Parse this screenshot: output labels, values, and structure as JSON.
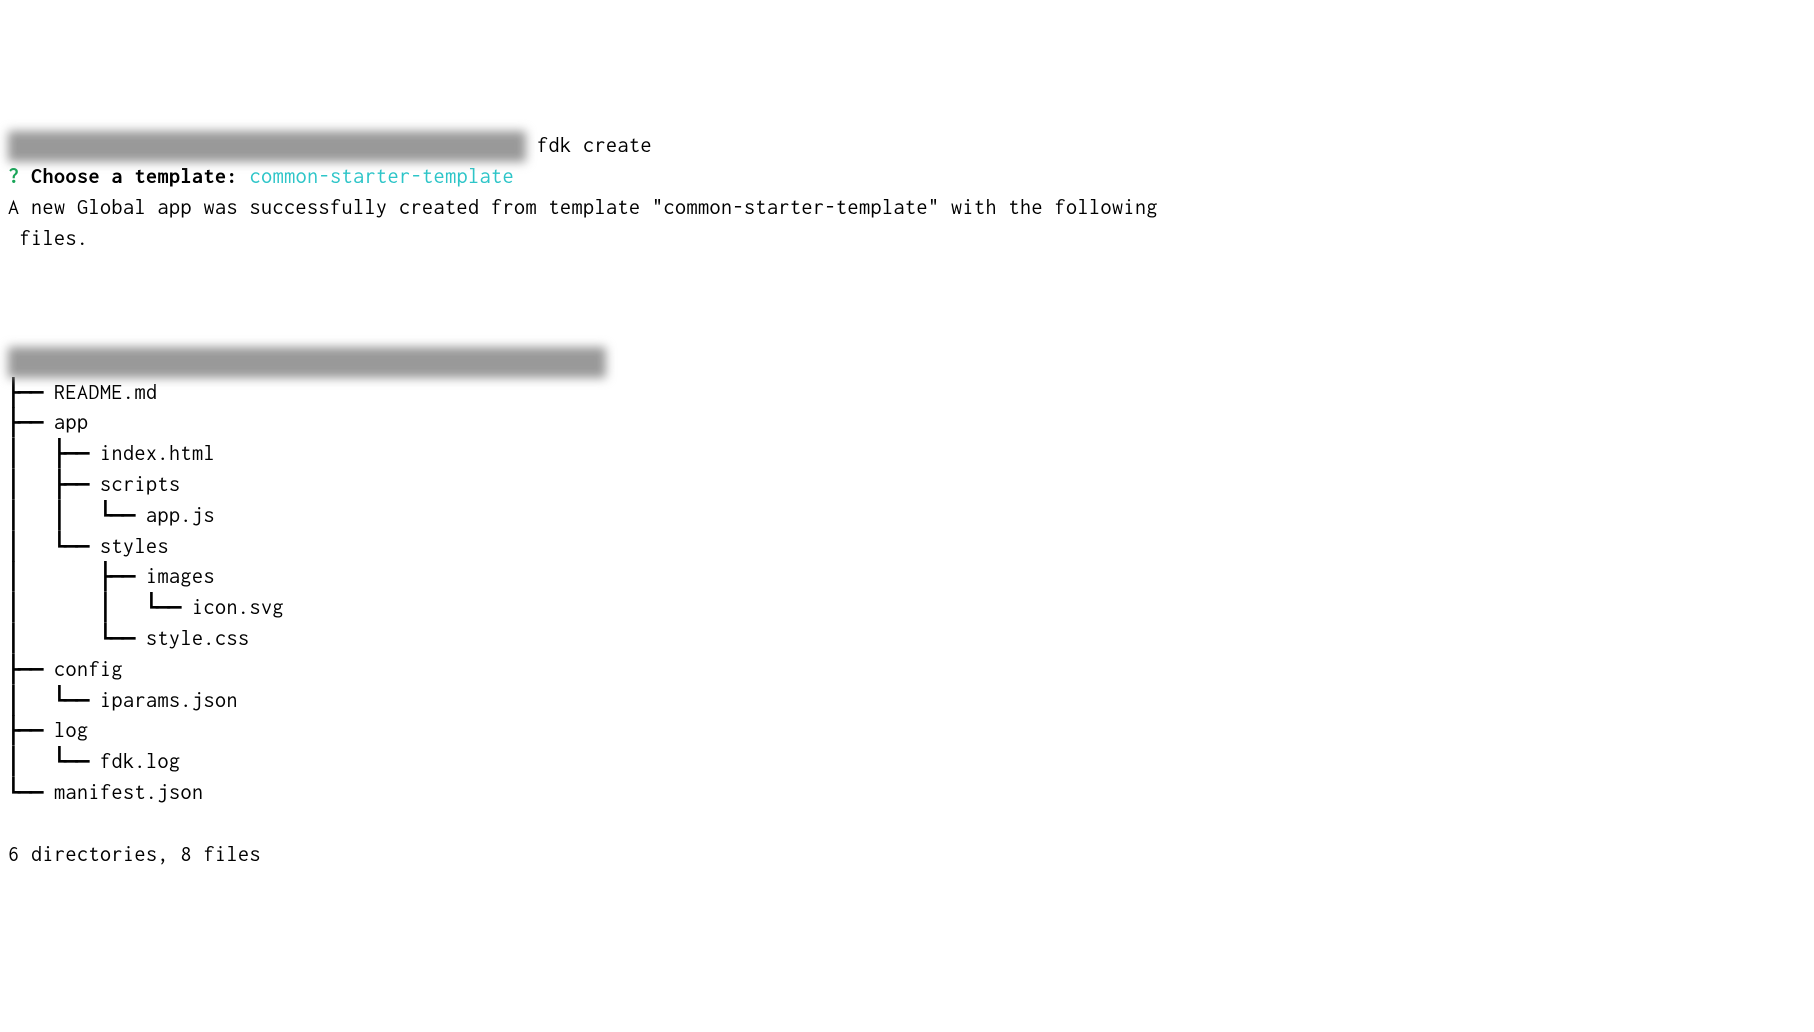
{
  "terminal": {
    "command_line": {
      "redacted_prefix": "████████████████████████████████████████████ ",
      "command": "fdk create"
    },
    "prompt": {
      "question_mark": "?",
      "label": "Choose a template:",
      "value": "common-starter-template"
    },
    "success_message": "A new Global app was successfully created from template \"common-starter-template\" with the following\n files.",
    "tree": {
      "root_redacted": "████████████████████████████████████████████████████",
      "lines": [
        "├── README.md",
        "├── app",
        "│   ├── index.html",
        "│   ├── scripts",
        "│   │   └── app.js",
        "│   └── styles",
        "│       ├── images",
        "│       │   └── icon.svg",
        "│       └── style.css",
        "├── config",
        "│   └── iparams.json",
        "├── log",
        "│   └── fdk.log",
        "└── manifest.json"
      ]
    },
    "summary": "6 directories, 8 files"
  }
}
